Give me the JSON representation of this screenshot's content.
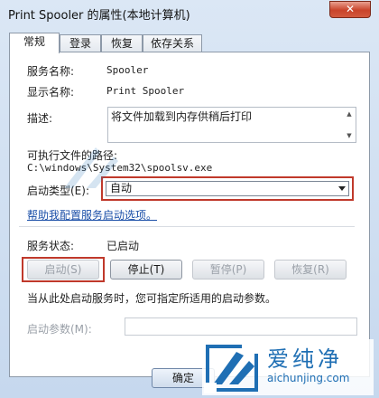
{
  "window": {
    "title": "Print Spooler 的属性(本地计算机)",
    "close_glyph": "✕"
  },
  "tabs": [
    {
      "label": "常规"
    },
    {
      "label": "登录"
    },
    {
      "label": "恢复"
    },
    {
      "label": "依存关系"
    }
  ],
  "general": {
    "service_name_label": "服务名称:",
    "service_name_value": "Spooler",
    "display_name_label": "显示名称:",
    "display_name_value": "Print Spooler",
    "description_label": "描述:",
    "description_value": "将文件加载到内存供稍后打印",
    "exe_path_label": "可执行文件的路径:",
    "exe_path_value": "C:\\windows\\System32\\spoolsv.exe",
    "startup_type_label": "启动类型(E):",
    "startup_type_value": "自动",
    "help_link": "帮助我配置服务启动选项。",
    "service_status_label": "服务状态:",
    "service_status_value": "已启动",
    "buttons": {
      "start": "启动(S)",
      "stop": "停止(T)",
      "pause": "暂停(P)",
      "resume": "恢复(R)"
    },
    "hint": "当从此处启动服务时，您可指定所适用的启动参数。",
    "start_params_label": "启动参数(M):",
    "start_params_value": ""
  },
  "footer": {
    "ok_label": "确定"
  },
  "watermark": {
    "brand": "爱纯净",
    "url": "aichunjing.com"
  },
  "colors": {
    "highlight": "#c0392b",
    "link": "#1b4fa8",
    "watermark": "#1f6fb4"
  }
}
